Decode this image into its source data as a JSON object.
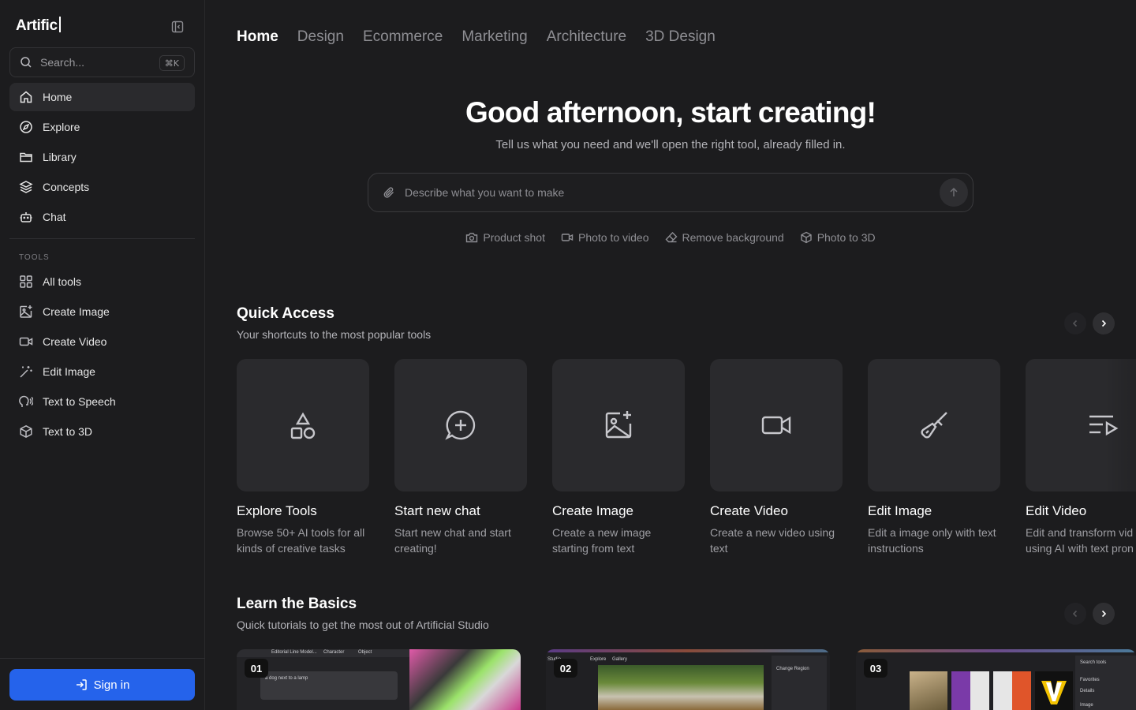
{
  "sidebar": {
    "brand": "Artific",
    "search": {
      "placeholder": "Search...",
      "shortcut": "⌘K"
    },
    "nav": [
      {
        "label": "Home",
        "icon": "home-icon",
        "active": true
      },
      {
        "label": "Explore",
        "icon": "compass-icon"
      },
      {
        "label": "Library",
        "icon": "folder-icon"
      },
      {
        "label": "Concepts",
        "icon": "layers-icon"
      },
      {
        "label": "Chat",
        "icon": "bot-icon"
      }
    ],
    "tools_label": "TOOLS",
    "tools": [
      {
        "label": "All tools",
        "icon": "grid-icon"
      },
      {
        "label": "Create Image",
        "icon": "image-plus-icon"
      },
      {
        "label": "Create Video",
        "icon": "video-icon"
      },
      {
        "label": "Edit Image",
        "icon": "magic-wand-icon"
      },
      {
        "label": "Text to Speech",
        "icon": "speech-icon"
      },
      {
        "label": "Text to 3D",
        "icon": "box-icon"
      }
    ],
    "signin_label": "Sign in"
  },
  "tabs": [
    "Home",
    "Design",
    "Ecommerce",
    "Marketing",
    "Architecture",
    "3D Design"
  ],
  "hero": {
    "title": "Good afternoon, start creating!",
    "subtitle": "Tell us what you need and we'll open the right tool, already filled in.",
    "prompt_placeholder": "Describe what you want to make",
    "chips": [
      {
        "label": "Product shot",
        "icon": "camera-icon"
      },
      {
        "label": "Photo to video",
        "icon": "video-icon"
      },
      {
        "label": "Remove background",
        "icon": "eraser-icon"
      },
      {
        "label": "Photo to 3D",
        "icon": "box-icon"
      }
    ]
  },
  "quick_access": {
    "title": "Quick Access",
    "subtitle": "Your shortcuts to the most popular tools",
    "cards": [
      {
        "title": "Explore Tools",
        "desc": "Browse 50+ AI tools for all kinds of creative tasks",
        "icon": "shapes-icon"
      },
      {
        "title": "Start new chat",
        "desc": "Start new chat and start creating!",
        "icon": "message-plus-icon"
      },
      {
        "title": "Create Image",
        "desc": "Create a new image starting from text",
        "icon": "image-plus-icon"
      },
      {
        "title": "Create Video",
        "desc": "Create a new video using text",
        "icon": "video-icon"
      },
      {
        "title": "Edit Image",
        "desc": "Edit a image only with text instructions",
        "icon": "brush-icon"
      },
      {
        "title": "Edit Video",
        "desc": "Edit and transform vid using AI with text pron",
        "icon": "list-video-icon"
      }
    ]
  },
  "basics": {
    "title": "Learn the Basics",
    "subtitle": "Quick tutorials to get the most out of Artificial Studio",
    "tutorials": [
      {
        "badge": "01",
        "caption_1": "Editorial Line Model...",
        "caption_2": "Character",
        "caption_3": "Object",
        "caption_4": "a dog next to a lamp"
      },
      {
        "badge": "02",
        "caption_1": "Studio",
        "caption_2": "Explore",
        "caption_3": "Gallery",
        "caption_4": "Change Region"
      },
      {
        "badge": "03",
        "caption_1": "Search tools",
        "caption_2": "Favorites",
        "caption_3": "Details",
        "caption_4": "Image"
      }
    ]
  },
  "colors": {
    "background": "#1c1c1e",
    "accent": "#2563eb",
    "card": "#2a2a2d"
  }
}
